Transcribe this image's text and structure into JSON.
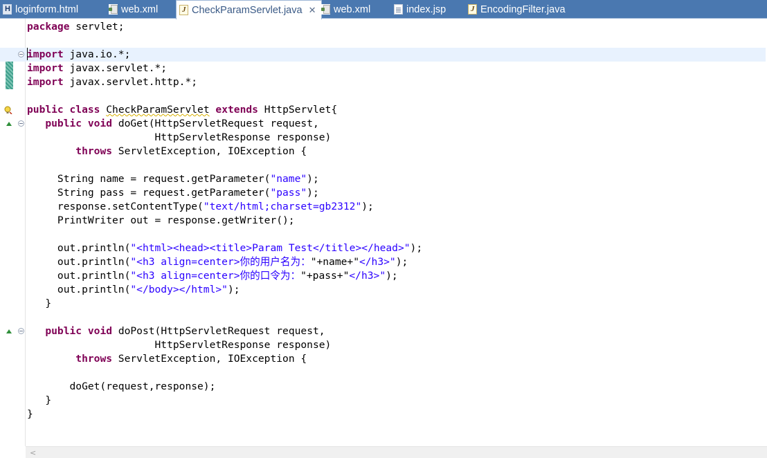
{
  "tabs": [
    {
      "label": "loginform.html",
      "icon": "html-file-icon",
      "active": false
    },
    {
      "label": "web.xml",
      "icon": "xml-file-icon",
      "active": false
    },
    {
      "label": "CheckParamServlet.java",
      "icon": "java-file-icon",
      "active": true,
      "close": "✕"
    },
    {
      "label": "web.xml",
      "icon": "xml-file-icon",
      "active": false
    },
    {
      "label": "index.jsp",
      "icon": "jsp-file-icon",
      "active": false
    },
    {
      "label": "EncodingFilter.java",
      "icon": "java-file-icon",
      "active": false
    }
  ],
  "code": [
    [
      [
        "kw",
        "package"
      ],
      [
        "t",
        " servlet;"
      ]
    ],
    [],
    [
      [
        "kw",
        "import"
      ],
      [
        "t",
        " java.io.*;"
      ]
    ],
    [
      [
        "kw",
        "import"
      ],
      [
        "t",
        " javax.servlet.*;"
      ]
    ],
    [
      [
        "kw",
        "import"
      ],
      [
        "t",
        " javax.servlet.http.*;"
      ]
    ],
    [],
    [
      [
        "kw",
        "public"
      ],
      [
        "t",
        " "
      ],
      [
        "kw",
        "class"
      ],
      [
        "t",
        " "
      ],
      [
        "w",
        "CheckParamServlet"
      ],
      [
        "t",
        " "
      ],
      [
        "kw",
        "extends"
      ],
      [
        "t",
        " HttpServlet{"
      ]
    ],
    [
      [
        "t",
        "   "
      ],
      [
        "kw",
        "public"
      ],
      [
        "t",
        " "
      ],
      [
        "kw",
        "void"
      ],
      [
        "t",
        " doGet(HttpServletRequest request,"
      ]
    ],
    [
      [
        "t",
        "                     HttpServletResponse response)"
      ]
    ],
    [
      [
        "t",
        "        "
      ],
      [
        "kw",
        "throws"
      ],
      [
        "t",
        " ServletException, IOException {"
      ]
    ],
    [],
    [
      [
        "t",
        "     String name = request.getParameter("
      ],
      [
        "str",
        "\"name\""
      ],
      [
        "t",
        ");"
      ]
    ],
    [
      [
        "t",
        "     String pass = request.getParameter("
      ],
      [
        "str",
        "\"pass\""
      ],
      [
        "t",
        ");"
      ]
    ],
    [
      [
        "t",
        "     response.setContentType("
      ],
      [
        "str",
        "\"text/html;charset=gb2312\""
      ],
      [
        "t",
        ");"
      ]
    ],
    [
      [
        "t",
        "     PrintWriter out = response.getWriter();"
      ]
    ],
    [],
    [
      [
        "t",
        "     out.println("
      ],
      [
        "str",
        "\"<html><head><title>Param Test</title></head>\""
      ],
      [
        "t",
        ");"
      ]
    ],
    [
      [
        "t",
        "     out.println("
      ],
      [
        "str",
        "\"<h3 align=center>你的用户名为："
      ],
      [
        "t",
        "\"+name+\""
      ],
      [
        "str",
        "</h3>\""
      ],
      [
        "t",
        ");"
      ]
    ],
    [
      [
        "t",
        "     out.println("
      ],
      [
        "str",
        "\"<h3 align=center>你的口令为："
      ],
      [
        "t",
        "\"+pass+\""
      ],
      [
        "str",
        "</h3>\""
      ],
      [
        "t",
        ");"
      ]
    ],
    [
      [
        "t",
        "     out.println("
      ],
      [
        "str",
        "\"</body></html>\""
      ],
      [
        "t",
        ");"
      ]
    ],
    [
      [
        "t",
        "   }"
      ]
    ],
    [],
    [
      [
        "t",
        "   "
      ],
      [
        "kw",
        "public"
      ],
      [
        "t",
        " "
      ],
      [
        "kw",
        "void"
      ],
      [
        "t",
        " doPost(HttpServletRequest request,"
      ]
    ],
    [
      [
        "t",
        "                     HttpServletResponse response)"
      ]
    ],
    [
      [
        "t",
        "        "
      ],
      [
        "kw",
        "throws"
      ],
      [
        "t",
        " ServletException, IOException {"
      ]
    ],
    [],
    [
      [
        "t",
        "       doGet(request,response);"
      ]
    ],
    [
      [
        "t",
        "   }"
      ]
    ],
    [
      [
        "t",
        "}"
      ]
    ]
  ],
  "current_line": 3,
  "gutter": {
    "change_marks": [
      3,
      4,
      5
    ],
    "override_markers": [
      8,
      23
    ],
    "fold_markers": [
      3,
      8,
      23
    ],
    "warning_marker": 7
  },
  "scrollbar": {
    "left_arrow": "<"
  }
}
